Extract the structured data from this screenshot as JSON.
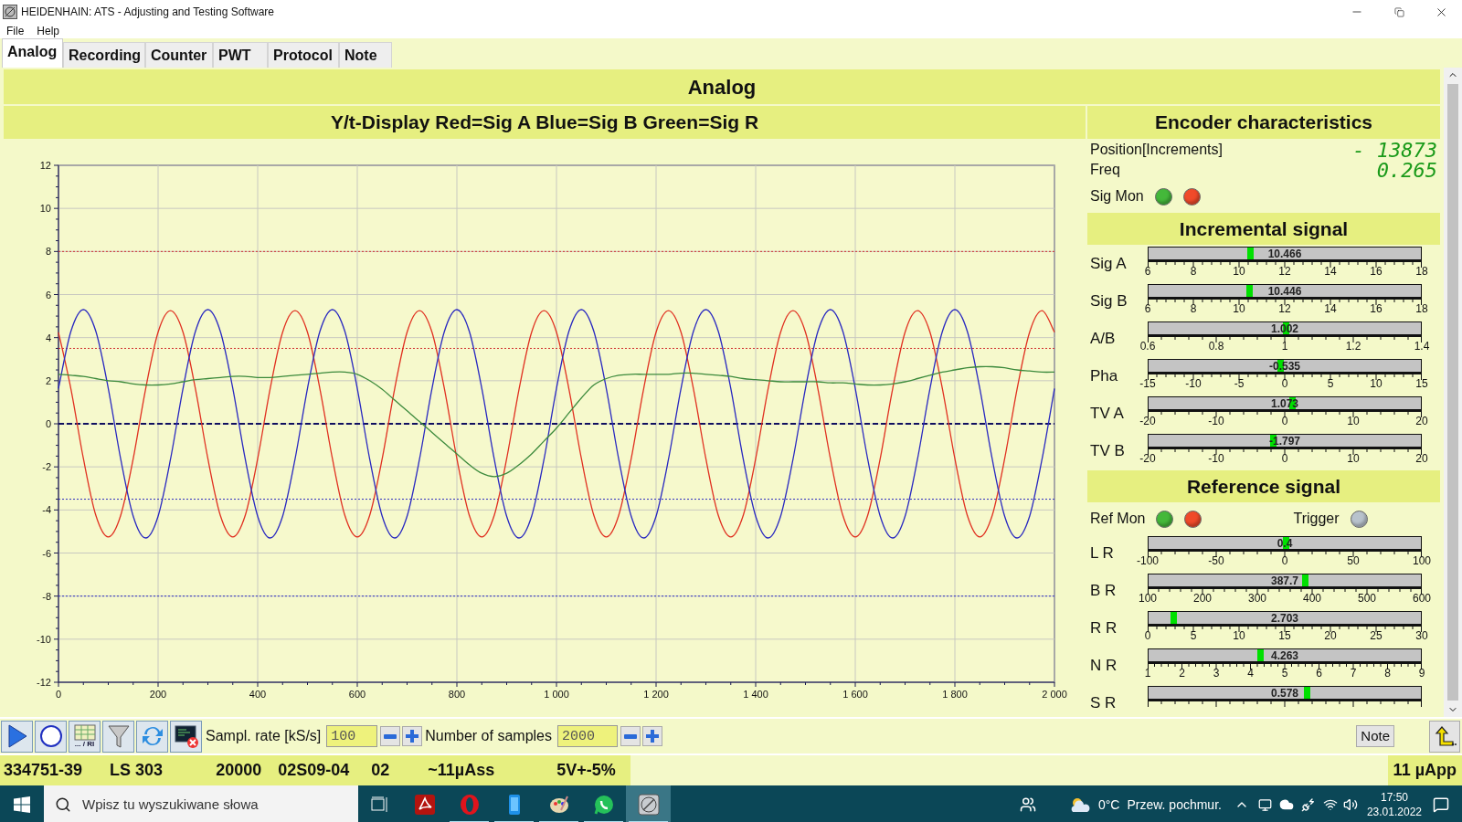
{
  "window": {
    "title": "HEIDENHAIN: ATS - Adjusting and Testing Software"
  },
  "menu": [
    "File",
    "Help"
  ],
  "tabs": [
    {
      "label": "Analog",
      "selected": true
    },
    {
      "label": "Recording",
      "selected": false
    },
    {
      "label": "Counter",
      "selected": false
    },
    {
      "label": "PWT",
      "selected": false
    },
    {
      "label": "Protocol",
      "selected": false
    },
    {
      "label": "Note",
      "selected": false
    }
  ],
  "page_title": "Analog",
  "chart_panel": {
    "title": "Y/t-Display Red=Sig A Blue=Sig B Green=Sig R",
    "chart_data": {
      "type": "line",
      "xlim": [
        0,
        2000
      ],
      "ylim": [
        -12,
        12
      ],
      "xticks": [
        0,
        200,
        400,
        600,
        800,
        {
          "value": 1000,
          "label": "1 000"
        },
        {
          "value": 1200,
          "label": "1 200"
        },
        {
          "value": 1400,
          "label": "1 400"
        },
        {
          "value": 1600,
          "label": "1 600"
        },
        {
          "value": 1800,
          "label": "1 800"
        },
        {
          "value": 2000,
          "label": "2 000"
        }
      ],
      "yticks": [
        -12,
        -10,
        -8,
        -6,
        -4,
        -2,
        0,
        2,
        4,
        6,
        8,
        10,
        12
      ],
      "x": [
        0,
        25,
        50,
        75,
        100,
        125,
        150,
        175,
        200,
        225,
        250,
        275,
        300,
        325,
        350,
        375,
        400,
        425,
        450,
        475,
        500,
        525,
        550,
        575,
        600,
        625,
        650,
        675,
        700,
        725,
        750,
        775,
        800,
        825,
        850,
        875,
        900,
        925,
        950,
        975,
        1000,
        1025,
        1050,
        1075,
        1100,
        1125,
        1150,
        1175,
        1200,
        1225,
        1250,
        1275,
        1300,
        1325,
        1350,
        1375,
        1400,
        1425,
        1450,
        1475,
        1500,
        1525,
        1550,
        1575,
        1600,
        1625,
        1650,
        1675,
        1700,
        1725,
        1750,
        1775,
        1800,
        1825,
        1850,
        1875,
        1900,
        1925,
        1950,
        1975,
        2000
      ],
      "series": [
        {
          "color": "#e03020",
          "values": [
            4.25,
            1.62,
            -1.62,
            -4.25,
            -5.25,
            -4.25,
            -1.62,
            1.62,
            4.25,
            5.25,
            4.25,
            1.62,
            -1.62,
            -4.25,
            -5.25,
            -4.25,
            -1.62,
            1.62,
            4.25,
            5.25,
            4.25,
            1.62,
            -1.62,
            -4.25,
            -5.25,
            -4.25,
            -1.62,
            1.62,
            4.25,
            5.25,
            4.25,
            1.62,
            -1.62,
            -4.25,
            -5.25,
            -4.25,
            -1.62,
            1.62,
            4.25,
            5.25,
            4.25,
            1.62,
            -1.62,
            -4.25,
            -5.25,
            -4.25,
            -1.62,
            1.62,
            4.25,
            5.25,
            4.25,
            1.62,
            -1.62,
            -4.25,
            -5.25,
            -4.25,
            -1.62,
            1.62,
            4.25,
            5.25,
            4.25,
            1.62,
            -1.62,
            -4.25,
            -5.25,
            -4.25,
            -1.62,
            1.62,
            4.25,
            5.25,
            4.25,
            1.62,
            -1.62,
            -4.25,
            -5.25,
            -4.25,
            -1.62,
            1.62,
            4.25,
            5.25,
            4.25
          ]
        },
        {
          "color": "#2828c0",
          "values": [
            1.64,
            4.29,
            5.3,
            4.29,
            1.64,
            -1.64,
            -4.29,
            -5.3,
            -4.29,
            -1.64,
            1.64,
            4.29,
            5.3,
            4.29,
            1.64,
            -1.64,
            -4.29,
            -5.3,
            -4.29,
            -1.64,
            1.64,
            4.29,
            5.3,
            4.29,
            1.64,
            -1.64,
            -4.29,
            -5.3,
            -4.29,
            -1.64,
            1.64,
            4.29,
            5.3,
            4.29,
            1.64,
            -1.64,
            -4.29,
            -5.3,
            -4.29,
            -1.64,
            1.64,
            4.29,
            5.3,
            4.29,
            1.64,
            -1.64,
            -4.29,
            -5.3,
            -4.29,
            -1.64,
            1.64,
            4.29,
            5.3,
            4.29,
            1.64,
            -1.64,
            -4.29,
            -5.3,
            -4.29,
            -1.64,
            1.64,
            4.29,
            5.3,
            4.29,
            1.64,
            -1.64,
            -4.29,
            -5.3,
            -4.29,
            -1.64,
            1.64,
            4.29,
            5.3,
            4.29,
            1.64,
            -1.64,
            -4.29,
            -5.3,
            -4.29,
            -1.64,
            1.64
          ]
        },
        {
          "color": "#3c8a3c",
          "values": [
            2.3,
            2.25,
            2.2,
            2.1,
            2.0,
            1.95,
            1.85,
            1.8,
            1.8,
            1.85,
            1.95,
            2.05,
            2.1,
            2.15,
            2.2,
            2.2,
            2.15,
            2.15,
            2.2,
            2.25,
            2.3,
            2.35,
            2.4,
            2.4,
            2.3,
            2.0,
            1.6,
            1.1,
            0.6,
            0.1,
            -0.4,
            -0.9,
            -1.4,
            -1.9,
            -2.3,
            -2.45,
            -2.3,
            -1.9,
            -1.4,
            -0.8,
            -0.2,
            0.5,
            1.2,
            1.8,
            2.1,
            2.25,
            2.3,
            2.3,
            2.3,
            2.3,
            2.35,
            2.35,
            2.3,
            2.25,
            2.2,
            2.1,
            2.05,
            2.0,
            1.95,
            1.95,
            1.95,
            1.95,
            1.9,
            1.9,
            1.85,
            1.8,
            1.8,
            1.85,
            1.95,
            2.1,
            2.25,
            2.4,
            2.5,
            2.6,
            2.65,
            2.65,
            2.6,
            2.5,
            2.45,
            2.4,
            2.4
          ]
        }
      ],
      "grid": true,
      "ref_lines": [
        {
          "axis": "y",
          "value": 8,
          "color": "#d03030"
        },
        {
          "axis": "y",
          "value": 3.5,
          "color": "#d03030"
        },
        {
          "axis": "y",
          "value": 0,
          "color": "#101060"
        },
        {
          "axis": "y",
          "value": -3.5,
          "color": "#3030c0"
        },
        {
          "axis": "y",
          "value": -8,
          "color": "#3030c0"
        }
      ]
    }
  },
  "encoder": {
    "title": "Encoder characteristics",
    "position_label": "Position[Increments]",
    "position_value": "- 13873",
    "freq_label": "Freq",
    "freq_value": "0.265",
    "sig_mon": {
      "label": "Sig Mon",
      "lamps": [
        {
          "color": "#44b83a"
        },
        {
          "color": "#f04a2a"
        }
      ]
    }
  },
  "incremental": {
    "title": "Incremental signal",
    "gauges": [
      {
        "label": "Sig A",
        "value": "10.466",
        "level": 0.372,
        "ticks": [
          "6",
          "8",
          "10",
          "12",
          "14",
          "16",
          "18"
        ]
      },
      {
        "label": "Sig B",
        "value": "10.446",
        "level": 0.37,
        "ticks": [
          "6",
          "8",
          "10",
          "12",
          "14",
          "16",
          "18"
        ]
      },
      {
        "label": "A/B",
        "value": "1.002",
        "level": 0.503,
        "ticks": [
          "0.6",
          "0.8",
          "1",
          "1.2",
          "1.4"
        ]
      },
      {
        "label": "Pha",
        "value": "-0.535",
        "level": 0.482,
        "ticks": [
          "-15",
          "-10",
          "-5",
          "0",
          "5",
          "10",
          "15"
        ]
      },
      {
        "label": "TV A",
        "value": "1.073",
        "level": 0.527,
        "ticks": [
          "-20",
          "-10",
          "0",
          "10",
          "20"
        ]
      },
      {
        "label": "TV B",
        "value": "-1.797",
        "level": 0.455,
        "ticks": [
          "-20",
          "-10",
          "0",
          "10",
          "20"
        ]
      }
    ]
  },
  "reference": {
    "title": "Reference signal",
    "ref_mon": {
      "label": "Ref Mon",
      "lamps": [
        {
          "color": "#44b83a"
        },
        {
          "color": "#f04a2a"
        }
      ]
    },
    "trigger": {
      "label": "Trigger",
      "color": "#b8c2cc"
    },
    "gauges": [
      {
        "label": "L R",
        "value": "0.4",
        "level": 0.502,
        "ticks": [
          "-100",
          "-50",
          "0",
          "50",
          "100"
        ]
      },
      {
        "label": "B R",
        "value": "387.7",
        "level": 0.575,
        "ticks": [
          "100",
          "200",
          "300",
          "400",
          "500",
          "600"
        ]
      },
      {
        "label": "R R",
        "value": "2.703",
        "level": 0.09,
        "ticks": [
          "0",
          "5",
          "10",
          "15",
          "20",
          "25",
          "30"
        ]
      },
      {
        "label": "N R",
        "value": "4.263",
        "level": 0.408,
        "ticks": [
          "1",
          "2",
          "3",
          "4",
          "5",
          "6",
          "7",
          "8",
          "9"
        ]
      },
      {
        "label": "S R",
        "value": "0.578",
        "level": 0.58
      }
    ]
  },
  "toolbar": {
    "icon_caption": "... / RI",
    "sample_rate": {
      "label": "Sampl. rate [kS/s]",
      "value": "100"
    },
    "samples": {
      "label": "Number of samples",
      "value": "2000"
    },
    "note_button": "Note"
  },
  "status_bar": {
    "fields": [
      "334751-39",
      "LS 303",
      "20000",
      "02S09-04",
      "02",
      "~11µAss",
      "5V+-5%"
    ],
    "right": "11 µApp"
  },
  "taskbar": {
    "search_placeholder": "Wpisz tu wyszukiwane słowa",
    "apps": [
      {
        "kind": "pdf",
        "running": false,
        "selected": false
      },
      {
        "kind": "opera",
        "running": true,
        "selected": false
      },
      {
        "kind": "phone",
        "running": true,
        "selected": false
      },
      {
        "kind": "paint",
        "running": true,
        "selected": false
      },
      {
        "kind": "chat",
        "running": true,
        "selected": false
      },
      {
        "kind": "ats",
        "running": true,
        "selected": true
      }
    ],
    "temperature": "0°C",
    "weather": "Przew. pochmur.",
    "time": "17:50",
    "date": "23.01.2022"
  }
}
